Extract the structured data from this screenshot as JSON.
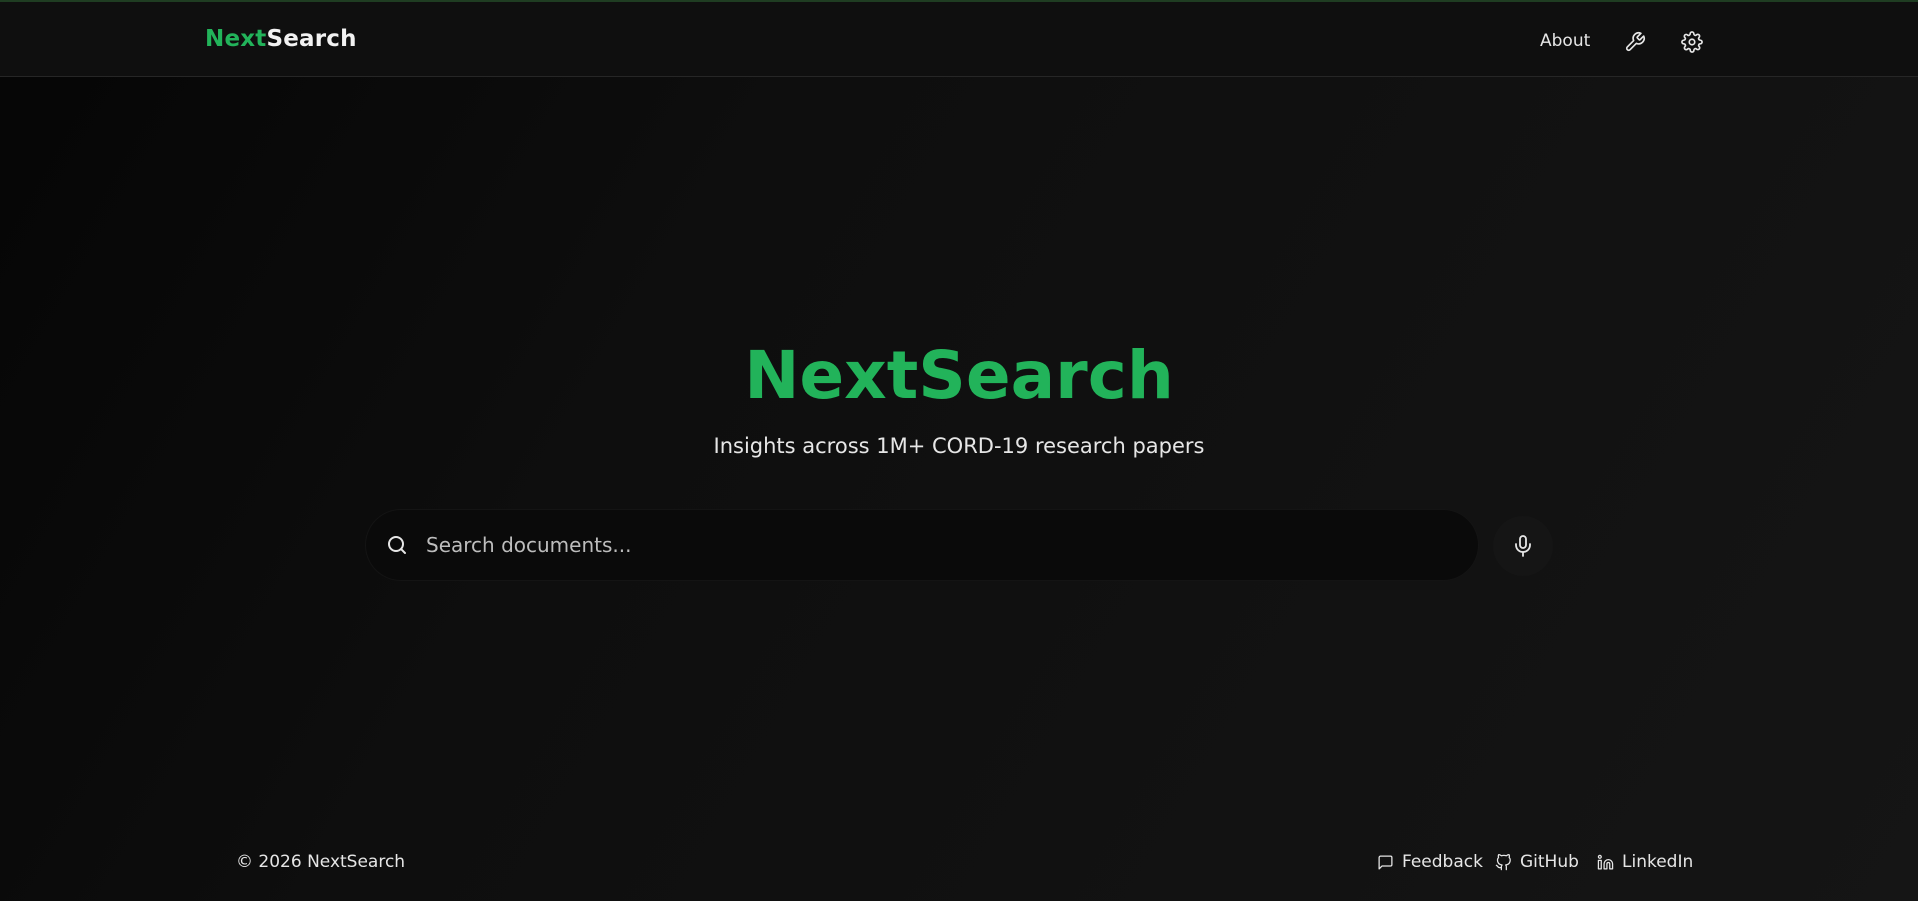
{
  "colors": {
    "accent": "#22b35a",
    "background": "#0f0f0f",
    "text": "#e6e6e6"
  },
  "header": {
    "brand_part1": "Next",
    "brand_part2": "Search",
    "nav_about": "About",
    "icons": [
      "wrench-icon",
      "gear-icon"
    ]
  },
  "hero": {
    "title": "NextSearch",
    "subtitle": "Insights across 1M+ CORD-19 research papers"
  },
  "search": {
    "placeholder": "Search documents...",
    "value": "",
    "icon": "search-icon",
    "mic_icon": "microphone-icon"
  },
  "footer": {
    "copyright": "© 2026 NextSearch",
    "links": [
      {
        "label": "Feedback",
        "icon": "message-square-icon"
      },
      {
        "label": "GitHub",
        "icon": "github-icon"
      },
      {
        "label": "LinkedIn",
        "icon": "linkedin-icon"
      }
    ]
  }
}
